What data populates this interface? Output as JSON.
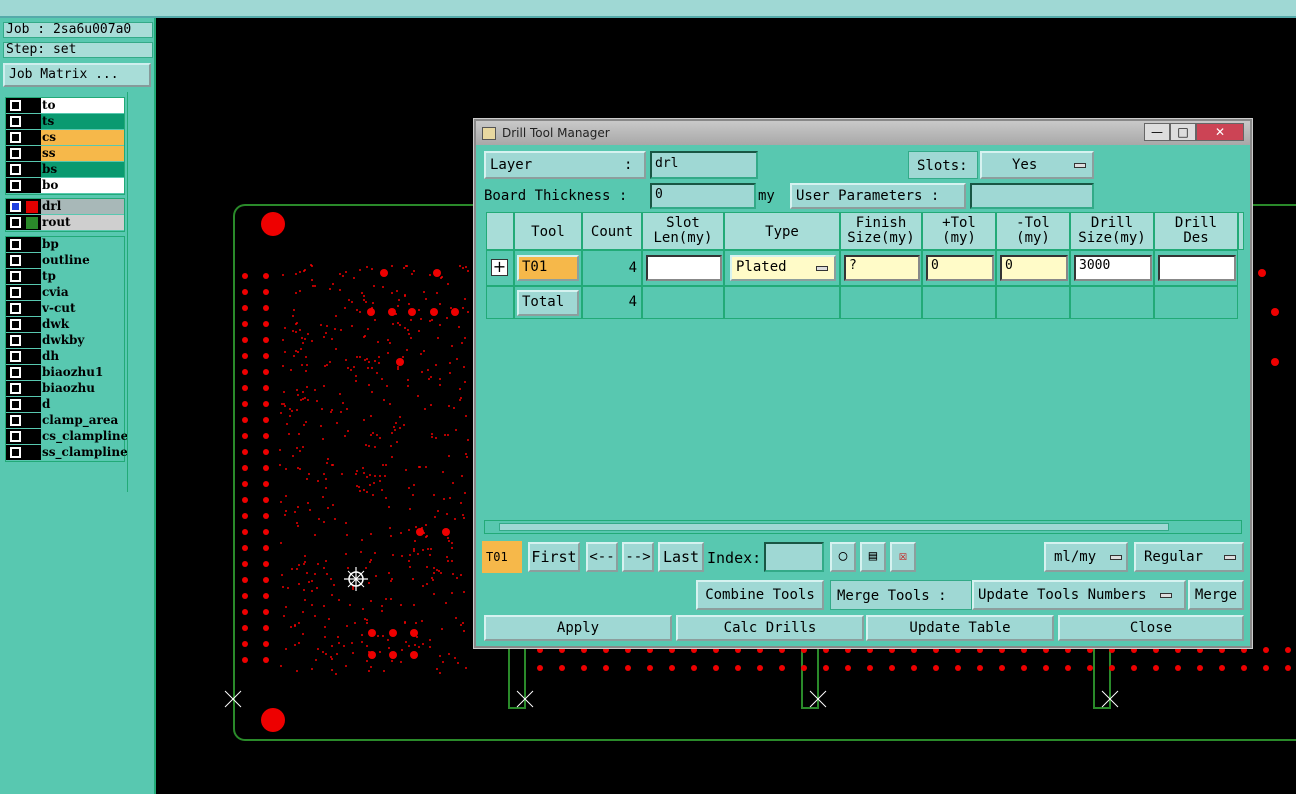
{
  "job": {
    "job_label": "Job : 2sa6u007a0",
    "step_label": "Step: set",
    "matrix_button": "Job Matrix ..."
  },
  "layers_top": [
    {
      "name": "to",
      "bg": "#ffffff"
    },
    {
      "name": "ts",
      "bg": "#0a9a70"
    },
    {
      "name": "cs",
      "bg": "#f6b84a"
    },
    {
      "name": "ss",
      "bg": "#f6b84a"
    },
    {
      "name": "bs",
      "bg": "#0a9a70"
    },
    {
      "name": "bo",
      "bg": "#ffffff"
    }
  ],
  "layers_mid": [
    {
      "name": "drl",
      "bg": "#a8b8b8",
      "swatch": "#e00000",
      "active": true
    },
    {
      "name": "rout",
      "bg": "#cfcfcf",
      "swatch": "#2a8a2a",
      "active": false
    }
  ],
  "layers_misc": [
    "bp",
    "outline",
    "tp",
    "cvia",
    "v-cut",
    "dwk",
    "dwkby",
    "dh",
    "biaozhu1",
    "biaozhu",
    "d",
    "clamp_area",
    "cs_clampline",
    "ss_clampline"
  ],
  "dialog": {
    "title": "Drill Tool Manager",
    "layer_label": "Layer",
    "layer_colon": ":",
    "layer_value": "drl",
    "slots_label": "Slots:",
    "slots_value": "Yes",
    "thickness_label": "Board Thickness :",
    "thickness_value": "0",
    "thickness_unit": "my",
    "user_params_label": "User Parameters :",
    "user_params_value": "",
    "columns": [
      {
        "l1": "",
        "l2": ""
      },
      {
        "l1": "Tool",
        "l2": ""
      },
      {
        "l1": "Count",
        "l2": ""
      },
      {
        "l1": "Slot",
        "l2": "Len(my)"
      },
      {
        "l1": "Type",
        "l2": ""
      },
      {
        "l1": "Finish",
        "l2": "Size(my)"
      },
      {
        "l1": "+Tol",
        "l2": "(my)"
      },
      {
        "l1": "-Tol",
        "l2": "(my)"
      },
      {
        "l1": "Drill",
        "l2": "Size(my)"
      },
      {
        "l1": "Drill",
        "l2": "Des"
      }
    ],
    "row": {
      "tool": "T01",
      "count": "4",
      "slot_len": "",
      "type": "Plated",
      "finish_size": "?",
      "plus_tol": "0",
      "minus_tol": "0",
      "drill_size": "3000",
      "drill_des": ""
    },
    "total": {
      "label": "Total",
      "count": "4"
    },
    "nav": {
      "current": "T01",
      "first": "First",
      "prev": "<--",
      "next": "-->",
      "last": "Last",
      "index_label": "Index:",
      "index_value": "",
      "units": "ml/my",
      "mode": "Regular"
    },
    "combine_button": "Combine Tools",
    "merge_label": "Merge Tools :",
    "merge_option": "Update Tools Numbers",
    "merge_button": "Merge",
    "apply_button": "Apply",
    "calc_button": "Calc Drills",
    "update_button": "Update Table",
    "close_button": "Close"
  }
}
